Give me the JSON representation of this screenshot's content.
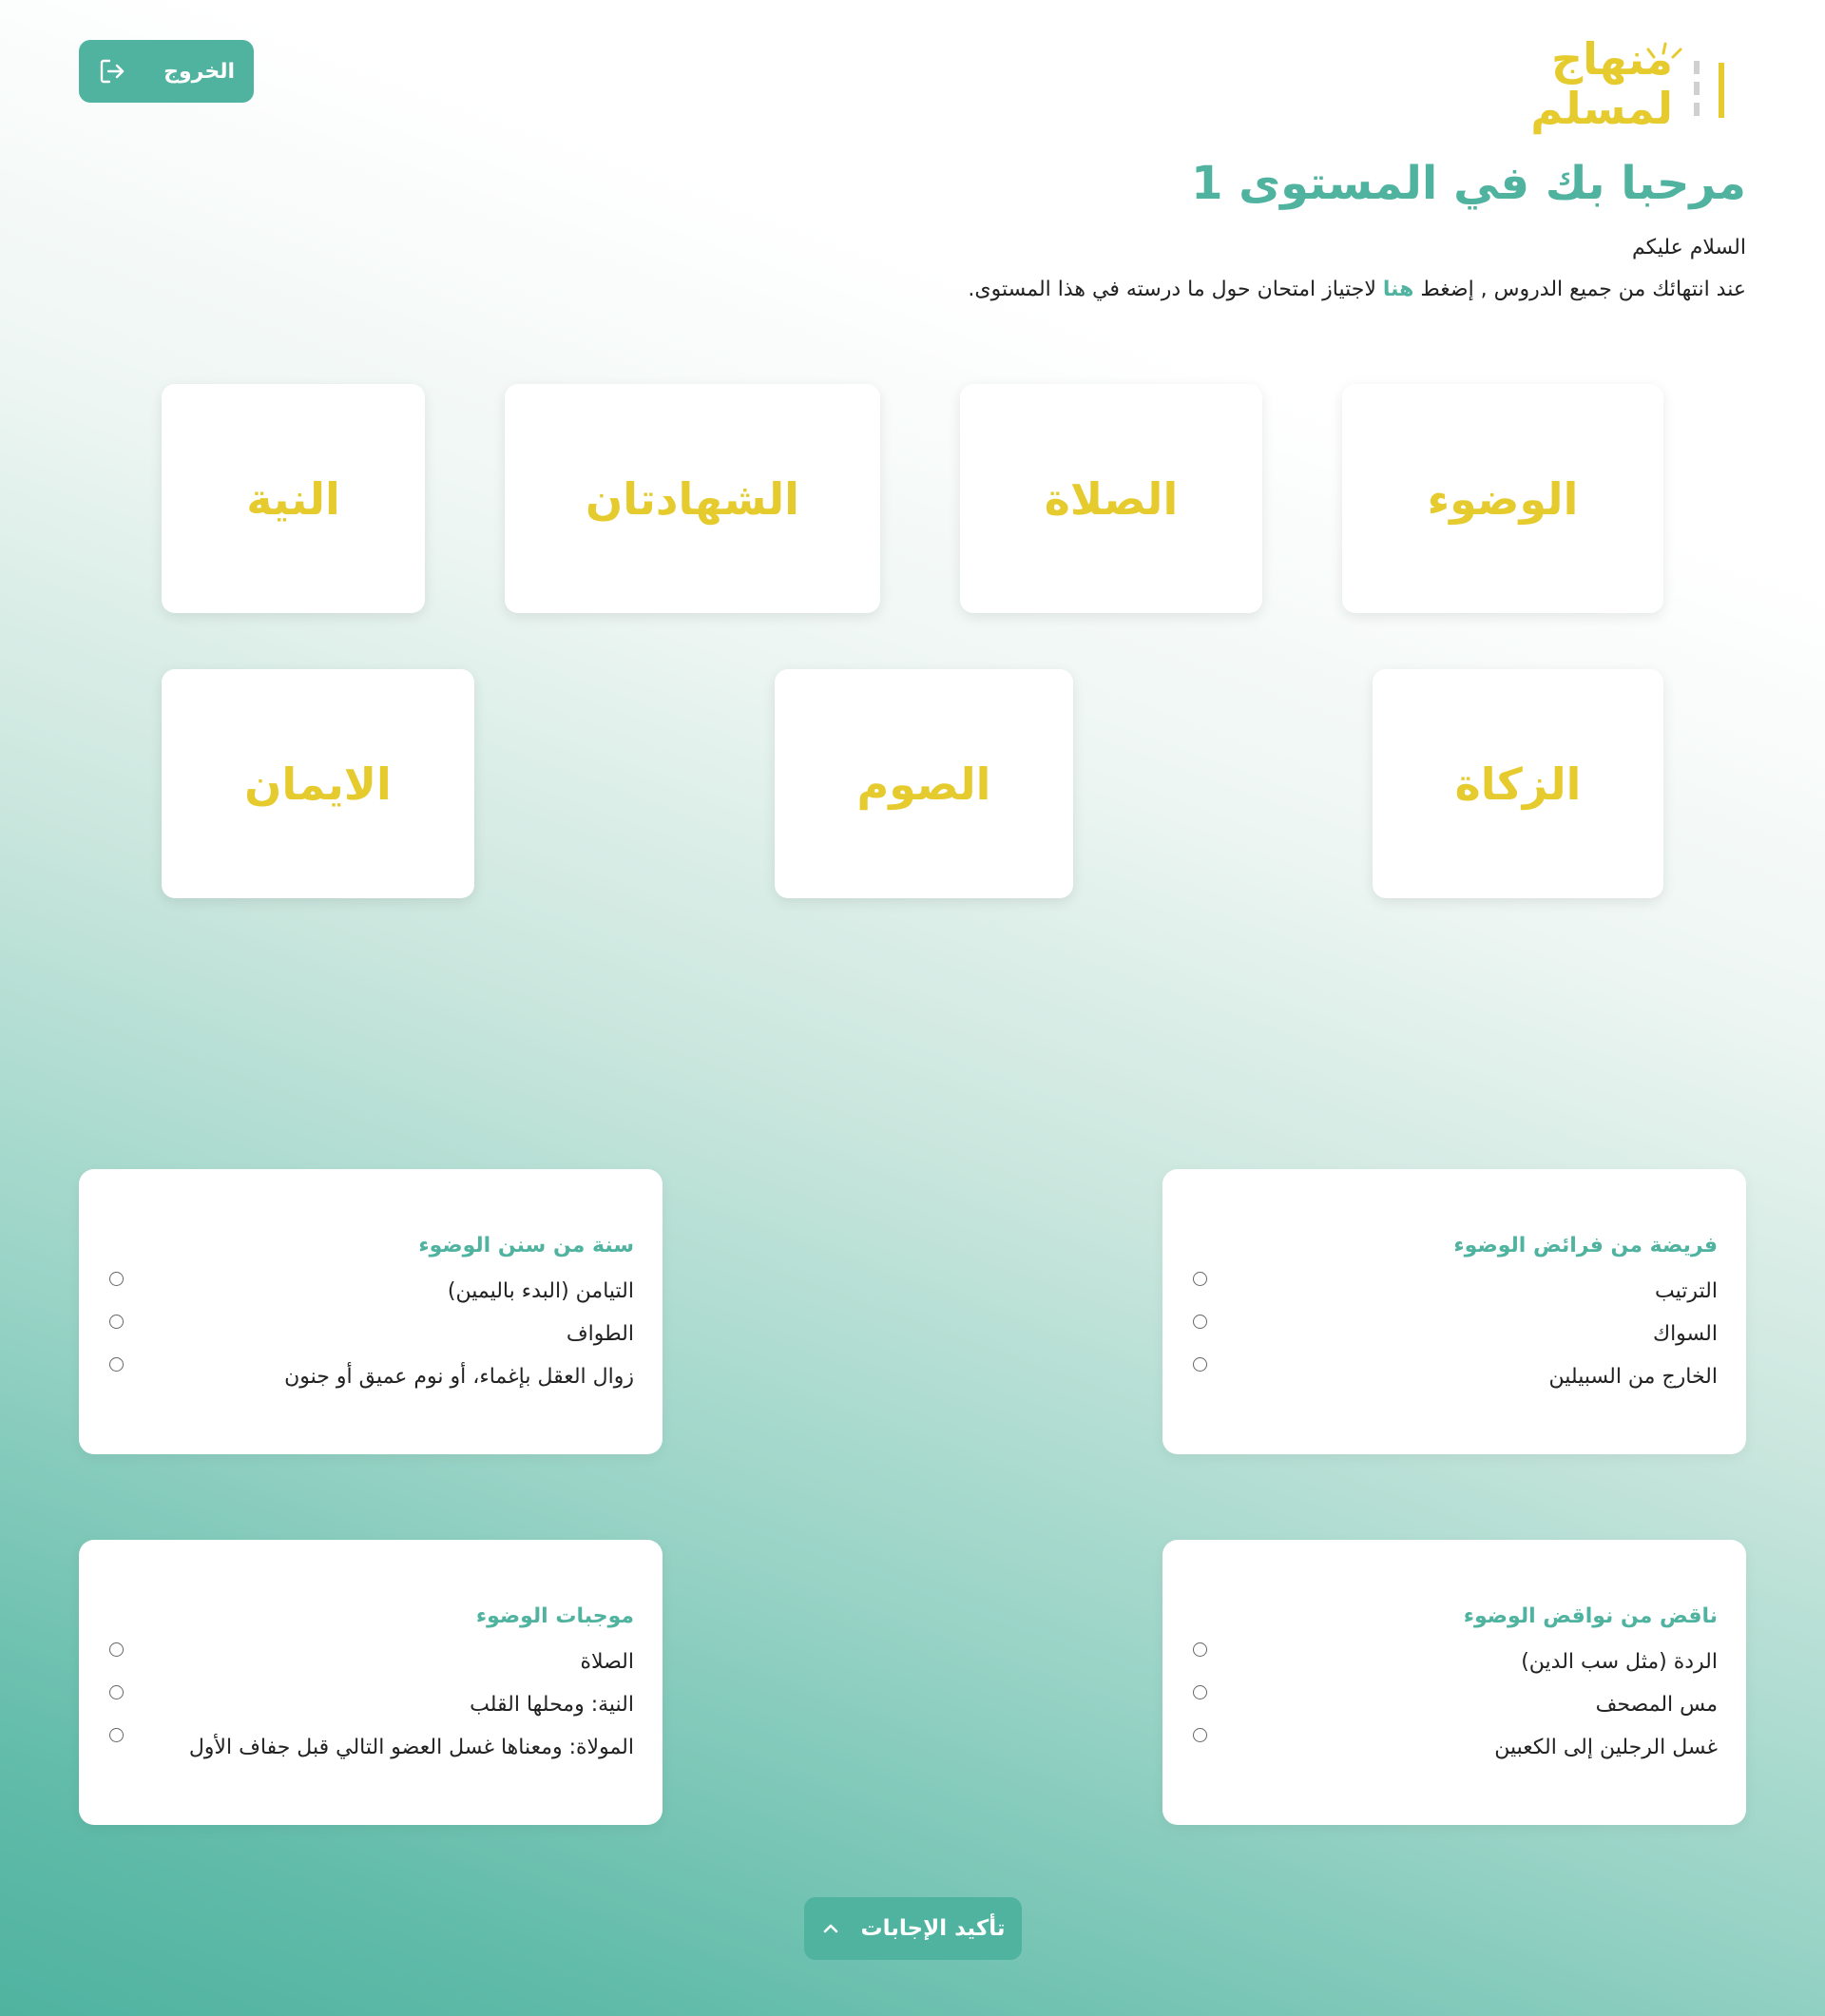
{
  "header": {
    "logout_label": "الخروج",
    "logo_line1": "منهاج",
    "logo_line2": "لمسلم"
  },
  "intro": {
    "title": "مرحبا بك في المستوى 1",
    "greeting": "السلام عليكم",
    "instruction_before": "عند انتهائك من جميع الدروس , إضغط ",
    "instruction_link": "هنا",
    "instruction_after": " لاجتياز امتحان حول ما درسته في هذا المستوى."
  },
  "lessons": [
    "الوضوء",
    "الصلاة",
    "الشهادتان",
    "النية",
    "الزكاة",
    "الصوم",
    "الايمان"
  ],
  "questions": [
    {
      "title": "فريضة من فرائض الوضوء",
      "options": [
        "الترتيب",
        "السواك",
        "الخارج من السبيلين"
      ]
    },
    {
      "title": "سنة من سنن الوضوء",
      "options": [
        "التيامن (البدء باليمين)",
        "الطواف",
        "زوال العقل بإغماء، أو نوم عميق أو جنون"
      ]
    },
    {
      "title": "ناقض من نواقض الوضوء",
      "options": [
        "الردة (مثل سب الدين)",
        "مس المصحف",
        "غسل الرجلين إلى الكعبين"
      ]
    },
    {
      "title": "موجبات الوضوء",
      "options": [
        "الصلاة",
        "النية: ومحلها القلب",
        "المولاة: ومعناها غسل العضو التالي قبل جفاف الأول"
      ]
    }
  ],
  "footer": {
    "confirm_label": "تأكيد الإجابات"
  },
  "colors": {
    "accent": "#4fb3a0",
    "lesson_text": "#e6cb2e",
    "logo_yellow": "#e6cb2e"
  },
  "icons": {
    "logout": "logout-icon",
    "confirm": "chevron-up-icon"
  }
}
